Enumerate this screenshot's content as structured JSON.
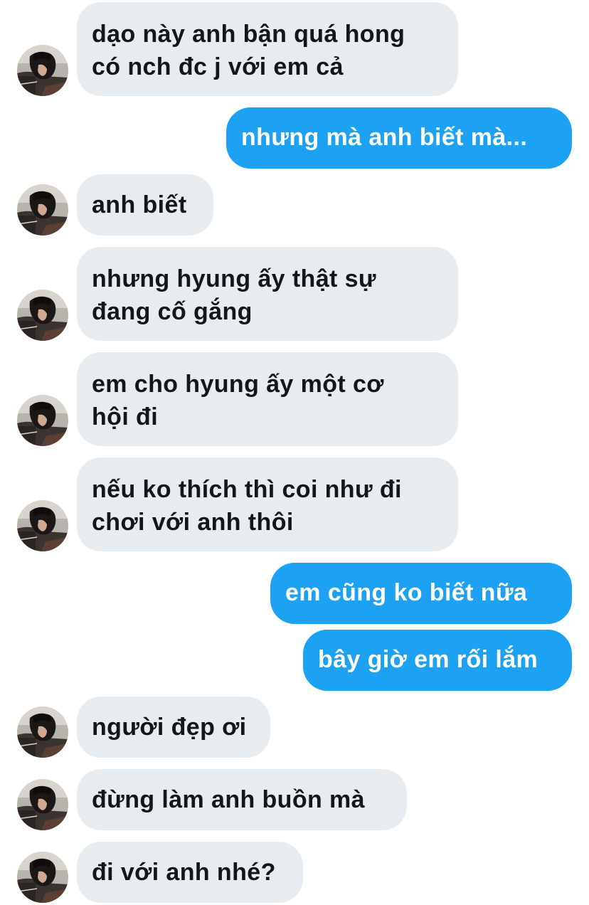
{
  "conversation": {
    "messages": [
      {
        "direction": "in",
        "text": "dạo này anh bận quá hong\ncó nch đc j với em cả"
      },
      {
        "direction": "out",
        "text": "nhưng mà anh biết mà..."
      },
      {
        "direction": "in",
        "text": "anh biết"
      },
      {
        "direction": "in",
        "text": "nhưng hyung ấy thật sự\nđang cố gắng"
      },
      {
        "direction": "in",
        "text": "em cho hyung ấy một cơ\nhội đi"
      },
      {
        "direction": "in",
        "text": "nếu ko thích thì coi như đi\nchơi với anh thôi"
      },
      {
        "direction": "out",
        "text": "em cũng ko biết nữa"
      },
      {
        "direction": "out",
        "text": "bây giờ em rối lắm"
      },
      {
        "direction": "in",
        "text": "người đẹp ơi"
      },
      {
        "direction": "in",
        "text": "đừng làm anh buồn mà"
      },
      {
        "direction": "in",
        "text": "đi với anh nhé?"
      }
    ]
  },
  "colors": {
    "incoming_bubble": "#e6ecf0",
    "incoming_text": "#14171a",
    "outgoing_bubble": "#1da1f2",
    "outgoing_text": "#ffffff"
  },
  "icons": {
    "avatar": "avatar-photo-icon"
  }
}
